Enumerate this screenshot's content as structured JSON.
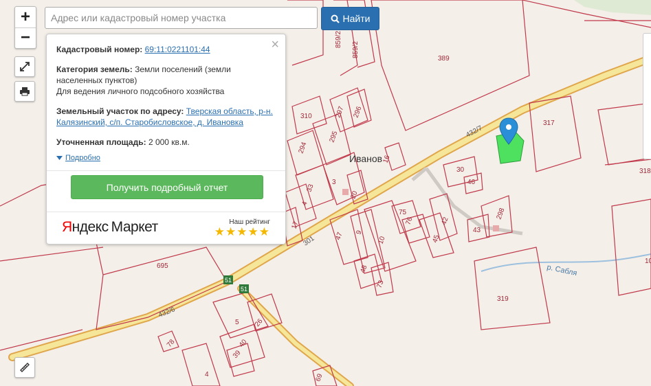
{
  "search": {
    "placeholder": "Адрес или кадастровый номер участка",
    "button_label": "Найти"
  },
  "controls": {
    "zoom_in": "+",
    "zoom_out": "−"
  },
  "popup": {
    "cadastral_label": "Кадастровый номер:",
    "cadastral_value": "69:11:0221101:44",
    "category_label": "Категория земель:",
    "category_value": "Земли поселений (земли населенных пунктов)",
    "use_value": "Для ведения личного подсобного хозяйства",
    "address_label": "Земельный участок по адресу:",
    "address_value": "Тверская область, р-н. Калязинский, с/п. Старобисловское, д. Ивановка",
    "area_label": "Уточненная площадь:",
    "area_value": "2 000 кв.м.",
    "more_label": "Подробно",
    "report_button": "Получить подробный отчет",
    "market_brand_y": "Я",
    "market_brand_rest": "ндекс",
    "market_brand_m": "Маркет",
    "rating_label": "Наш рейтинг",
    "rating_stars": "★★★★★"
  },
  "map_labels": {
    "village": "Иванов",
    "river": "р. Сабля",
    "road_1": "432/7",
    "road_2": "432/6",
    "road_3": "301",
    "shield_1": "51",
    "shield_2": "51",
    "parcels": [
      "389",
      "859/2",
      "859/2",
      "310",
      "297",
      "296",
      "295",
      "294",
      "16",
      "30",
      "46",
      "317",
      "3",
      "33",
      "20",
      "4",
      "17",
      "75",
      "76",
      "42",
      "298",
      "43",
      "45",
      "47",
      "9",
      "10",
      "48",
      "73",
      "695",
      "319",
      "5",
      "26",
      "40",
      "39",
      "4",
      "78",
      "69",
      "318",
      "10"
    ]
  },
  "colors": {
    "parcel_line": "#c0394b",
    "road_fill": "#f5e79a",
    "road_edge": "#e0a64c",
    "selected_parcel": "#4ee05f",
    "marker": "#2a8fd6",
    "river": "#8fb8d8"
  }
}
